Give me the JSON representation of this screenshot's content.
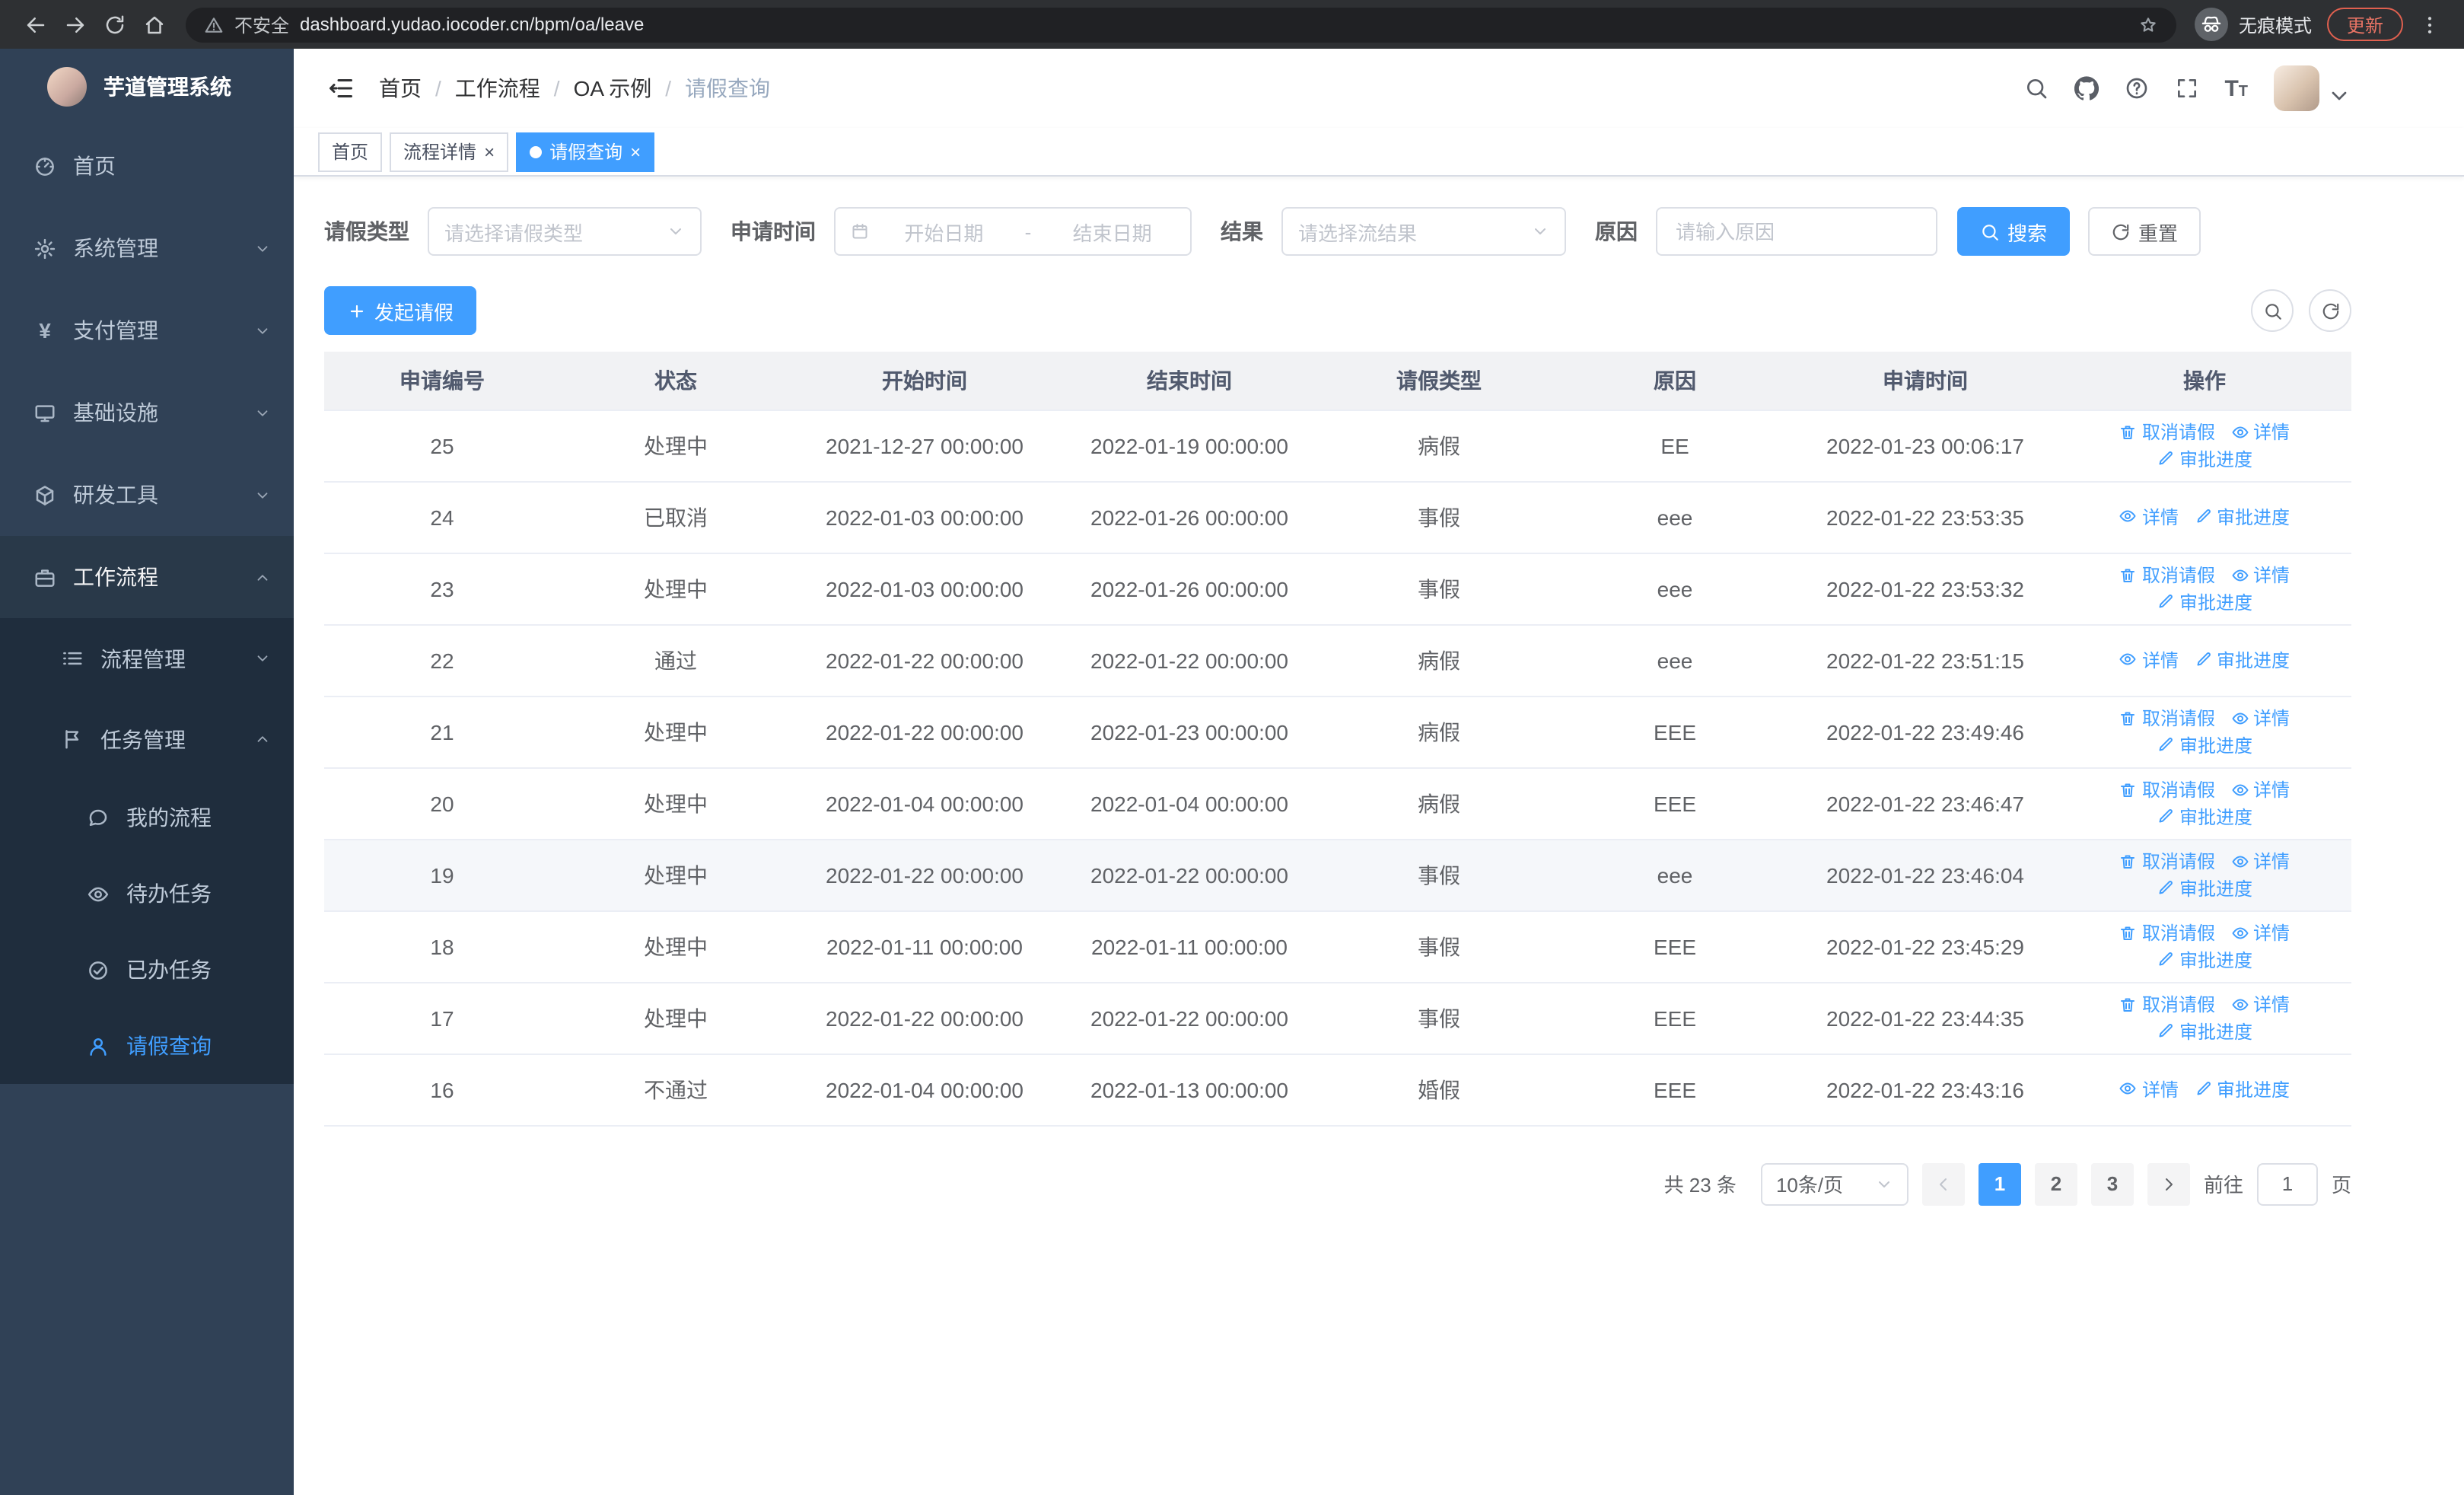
{
  "colors": {
    "primary": "#409eff",
    "sidebar_bg": "#304156",
    "sidebar_sub_bg": "#1f2d3d",
    "update_accent": "#e87364"
  },
  "ui": {
    "breadcrumb_separator": "/",
    "close_glyph": "×"
  },
  "browser": {
    "url": "dashboard.yudao.iocoder.cn/bpm/oa/leave",
    "security_label": "不安全",
    "incognito_label": "无痕模式",
    "update_label": "更新"
  },
  "sidebar": {
    "logo_title": "芋道管理系统",
    "menu": [
      {
        "key": "home",
        "label": "首页",
        "icon": "dashboard"
      },
      {
        "key": "system",
        "label": "系统管理",
        "icon": "gear",
        "chevron": "down"
      },
      {
        "key": "payment",
        "label": "支付管理",
        "icon": "yen",
        "chevron": "down"
      },
      {
        "key": "infrastructure",
        "label": "基础设施",
        "icon": "monitor",
        "chevron": "down"
      },
      {
        "key": "devtools",
        "label": "研发工具",
        "icon": "cube",
        "chevron": "down"
      },
      {
        "key": "workflow",
        "label": "工作流程",
        "icon": "briefcase",
        "chevron": "up",
        "open": true,
        "children": [
          {
            "key": "process-mgmt",
            "label": "流程管理",
            "icon": "list",
            "chevron": "down"
          },
          {
            "key": "task-mgmt",
            "label": "任务管理",
            "icon": "flag",
            "chevron": "up",
            "open": true,
            "children": [
              {
                "key": "my-process",
                "label": "我的流程",
                "icon": "chat"
              },
              {
                "key": "todo-task",
                "label": "待办任务",
                "icon": "eye"
              },
              {
                "key": "done-task",
                "label": "已办任务",
                "icon": "check-circle"
              },
              {
                "key": "leave-query",
                "label": "请假查询",
                "icon": "user",
                "active": true
              }
            ]
          }
        ]
      }
    ]
  },
  "header": {
    "breadcrumb": [
      "首页",
      "工作流程",
      "OA 示例",
      "请假查询"
    ]
  },
  "tabs": [
    {
      "key": "home",
      "label": "首页",
      "closable": false,
      "active": false
    },
    {
      "key": "process-detail",
      "label": "流程详情",
      "closable": true,
      "active": false
    },
    {
      "key": "leave-query",
      "label": "请假查询",
      "closable": true,
      "active": true
    }
  ],
  "filters": {
    "leave_type_label": "请假类型",
    "leave_type_placeholder": "请选择请假类型",
    "apply_time_label": "申请时间",
    "start_date_placeholder": "开始日期",
    "range_separator": "-",
    "end_date_placeholder": "结束日期",
    "result_label": "结果",
    "result_placeholder": "请选择流结果",
    "reason_label": "原因",
    "reason_placeholder": "请输入原因",
    "search_button": "搜索",
    "reset_button": "重置"
  },
  "toolbar": {
    "create_button": "发起请假"
  },
  "table": {
    "columns": [
      "申请编号",
      "状态",
      "开始时间",
      "结束时间",
      "请假类型",
      "原因",
      "申请时间",
      "操作"
    ],
    "action_labels": {
      "cancel": "取消请假",
      "detail": "详情",
      "progress": "审批进度"
    },
    "rows": [
      {
        "id": "25",
        "status": "处理中",
        "start": "2021-12-27 00:00:00",
        "end": "2022-01-19 00:00:00",
        "type": "病假",
        "reason": "EE",
        "applied": "2022-01-23 00:06:17",
        "actions": [
          "cancel",
          "detail",
          "progress"
        ]
      },
      {
        "id": "24",
        "status": "已取消",
        "start": "2022-01-03 00:00:00",
        "end": "2022-01-26 00:00:00",
        "type": "事假",
        "reason": "eee",
        "applied": "2022-01-22 23:53:35",
        "actions": [
          "detail",
          "progress"
        ]
      },
      {
        "id": "23",
        "status": "处理中",
        "start": "2022-01-03 00:00:00",
        "end": "2022-01-26 00:00:00",
        "type": "事假",
        "reason": "eee",
        "applied": "2022-01-22 23:53:32",
        "actions": [
          "cancel",
          "detail",
          "progress"
        ]
      },
      {
        "id": "22",
        "status": "通过",
        "start": "2022-01-22 00:00:00",
        "end": "2022-01-22 00:00:00",
        "type": "病假",
        "reason": "eee",
        "applied": "2022-01-22 23:51:15",
        "actions": [
          "detail",
          "progress"
        ]
      },
      {
        "id": "21",
        "status": "处理中",
        "start": "2022-01-22 00:00:00",
        "end": "2022-01-23 00:00:00",
        "type": "病假",
        "reason": "EEE",
        "applied": "2022-01-22 23:49:46",
        "actions": [
          "cancel",
          "detail",
          "progress"
        ]
      },
      {
        "id": "20",
        "status": "处理中",
        "start": "2022-01-04 00:00:00",
        "end": "2022-01-04 00:00:00",
        "type": "病假",
        "reason": "EEE",
        "applied": "2022-01-22 23:46:47",
        "actions": [
          "cancel",
          "detail",
          "progress"
        ]
      },
      {
        "id": "19",
        "status": "处理中",
        "start": "2022-01-22 00:00:00",
        "end": "2022-01-22 00:00:00",
        "type": "事假",
        "reason": "eee",
        "applied": "2022-01-22 23:46:04",
        "actions": [
          "cancel",
          "detail",
          "progress"
        ],
        "hover": true
      },
      {
        "id": "18",
        "status": "处理中",
        "start": "2022-01-11 00:00:00",
        "end": "2022-01-11 00:00:00",
        "type": "事假",
        "reason": "EEE",
        "applied": "2022-01-22 23:45:29",
        "actions": [
          "cancel",
          "detail",
          "progress"
        ]
      },
      {
        "id": "17",
        "status": "处理中",
        "start": "2022-01-22 00:00:00",
        "end": "2022-01-22 00:00:00",
        "type": "事假",
        "reason": "EEE",
        "applied": "2022-01-22 23:44:35",
        "actions": [
          "cancel",
          "detail",
          "progress"
        ]
      },
      {
        "id": "16",
        "status": "不通过",
        "start": "2022-01-04 00:00:00",
        "end": "2022-01-13 00:00:00",
        "type": "婚假",
        "reason": "EEE",
        "applied": "2022-01-22 23:43:16",
        "actions": [
          "detail",
          "progress"
        ]
      }
    ]
  },
  "pagination": {
    "total_text": "共 23 条",
    "page_size": "10条/页",
    "pages": [
      "1",
      "2",
      "3"
    ],
    "active_page": "1",
    "goto_prefix": "前往",
    "goto_value": "1",
    "goto_suffix": "页"
  }
}
